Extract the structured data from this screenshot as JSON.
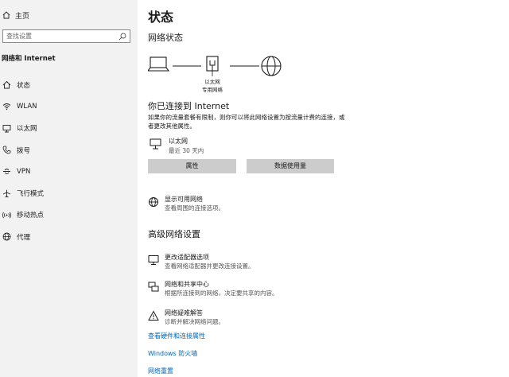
{
  "sidebar": {
    "home_label": "主页",
    "search_placeholder": "查找设置",
    "section_title": "网络和 Internet",
    "items": [
      {
        "label": "状态",
        "icon": "home-icon"
      },
      {
        "label": "WLAN",
        "icon": "wifi-icon"
      },
      {
        "label": "以太网",
        "icon": "ethernet-icon"
      },
      {
        "label": "拨号",
        "icon": "phone-icon"
      },
      {
        "label": "VPN",
        "icon": "vpn-icon"
      },
      {
        "label": "飞行模式",
        "icon": "airplane-icon"
      },
      {
        "label": "移动热点",
        "icon": "hotspot-icon"
      },
      {
        "label": "代理",
        "icon": "globe-icon"
      }
    ]
  },
  "main": {
    "page_title": "状态",
    "network_status_title": "网络状态",
    "diagram": {
      "adapter_label_1": "以太网",
      "adapter_label_2": "专用网络"
    },
    "connected_title": "你已连接到 Internet",
    "connected_desc": "如果你的流量套餐有限制，则你可以将此网络设置为按流量计费的连接，或者更改其他属性。",
    "adapter_name": "以太网",
    "adapter_sub": "最近 30 天内",
    "properties_button": "属性",
    "data_usage_button": "数据使用量",
    "show_networks_title": "显示可用网络",
    "show_networks_sub": "查看周围的连接选项。",
    "advanced_title": "高级网络设置",
    "adv_items": [
      {
        "title": "更改适配器选项",
        "sub": "查看网络适配器并更改连接设置。"
      },
      {
        "title": "网络和共享中心",
        "sub": "根据所连接到的网络，决定要共享的内容。"
      },
      {
        "title": "网络疑难解答",
        "sub": "诊断并解决网络问题。"
      }
    ],
    "links": [
      "查看硬件和连接属性",
      "Windows 防火墙",
      "网络重置"
    ]
  },
  "colors": {
    "link": "#0067b8",
    "sidebar_bg": "#f2f2f2",
    "button_bg": "#cccccc"
  }
}
